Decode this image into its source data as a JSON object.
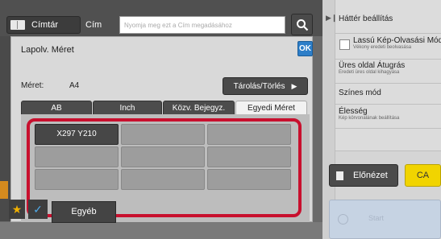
{
  "topbar": {
    "address_book_label": "Címtár",
    "address_label": "Cím",
    "address_placeholder": "Nyomja meg ezt a Cím megadásához"
  },
  "dialog": {
    "title": "Lapolv. Méret",
    "ok_label": "OK",
    "size_label": "Méret:",
    "size_value": "A4",
    "store_delete_label": "Tárolás/Törlés",
    "tabs": [
      {
        "label": "AB",
        "active": false
      },
      {
        "label": "Inch",
        "active": false
      },
      {
        "label": "Közv. Bejegyz.",
        "active": false
      },
      {
        "label": "Egyedi Méret",
        "active": true
      }
    ],
    "custom_sizes": [
      "X297 Y210",
      "",
      "",
      "",
      "",
      "",
      "",
      "",
      ""
    ]
  },
  "right_panel": {
    "header": "Háttér beállítás",
    "items": [
      {
        "title": "Lassú Kép-Olvasási Mód",
        "sub": "Vékony eredeti beolvasása"
      },
      {
        "title": "Üres oldal Átugrás",
        "sub": "Eredeti üres oldal kihagyása"
      },
      {
        "title": "Színes mód",
        "sub": ""
      },
      {
        "title": "Élesség",
        "sub": "Kép körvonalának beállítása"
      }
    ],
    "preview_label": "Előnézet",
    "ca_label": "CA",
    "start_label": "Start"
  },
  "bottom": {
    "other_label": "Egyéb"
  },
  "colors": {
    "ok_blue": "#2d7ec8",
    "ca_yellow": "#f1d400",
    "highlight_red": "#c8102e",
    "star_orange": "#f0b000",
    "check_blue": "#4fa9e8"
  }
}
